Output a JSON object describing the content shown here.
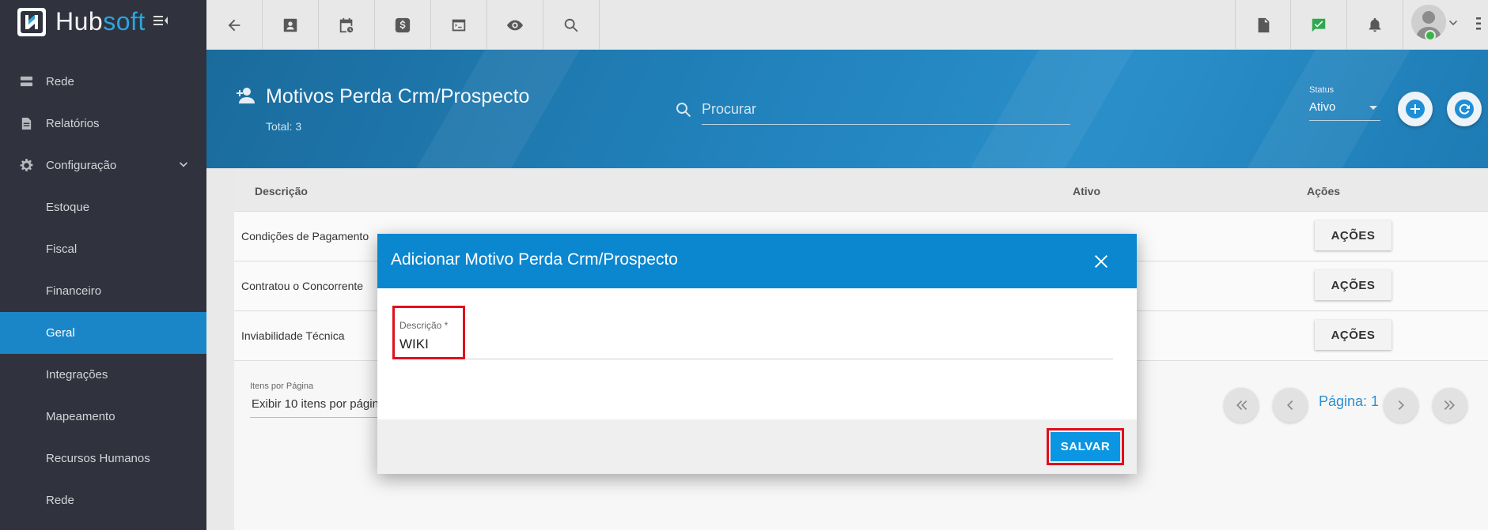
{
  "brand": {
    "part1": "Hub",
    "part2": "soft"
  },
  "sidebar": {
    "items": [
      {
        "label": "Rede",
        "icon": "server-icon"
      },
      {
        "label": "Relatórios",
        "icon": "document-icon"
      },
      {
        "label": "Configuração",
        "icon": "gear-icon"
      }
    ],
    "subitems": [
      {
        "label": "Estoque"
      },
      {
        "label": "Fiscal"
      },
      {
        "label": "Financeiro"
      },
      {
        "label": "Geral",
        "active": true
      },
      {
        "label": "Integrações"
      },
      {
        "label": "Mapeamento"
      },
      {
        "label": "Recursos Humanos"
      },
      {
        "label": "Rede"
      }
    ]
  },
  "header": {
    "title": "Motivos Perda Crm/Prospecto",
    "total": "Total: 3",
    "search_placeholder": "Procurar",
    "status_label": "Status",
    "status_value": "Ativo"
  },
  "table": {
    "columns": [
      "Descrição",
      "Ativo",
      "Ações"
    ],
    "rows": [
      {
        "descricao": "Condições de Pagamento",
        "acoes": "AÇÕES"
      },
      {
        "descricao": "Contratou o Concorrente",
        "acoes": "AÇÕES"
      },
      {
        "descricao": "Inviabilidade Técnica",
        "acoes": "AÇÕES"
      }
    ]
  },
  "pagination": {
    "items_label": "Itens por Página",
    "items_value": "Exibir 10 itens por página",
    "page_label": "Página: 1"
  },
  "modal": {
    "title": "Adicionar Motivo Perda Crm/Prospecto",
    "field_label": "Descrição *",
    "field_value": "WIKI",
    "save_label": "SALVAR"
  },
  "colors": {
    "sidebar_bg": "#30323d",
    "accent": "#1a86c8",
    "modal_header": "#0b87d0",
    "highlight": "#e0101c",
    "active_green": "#3bb54a"
  }
}
